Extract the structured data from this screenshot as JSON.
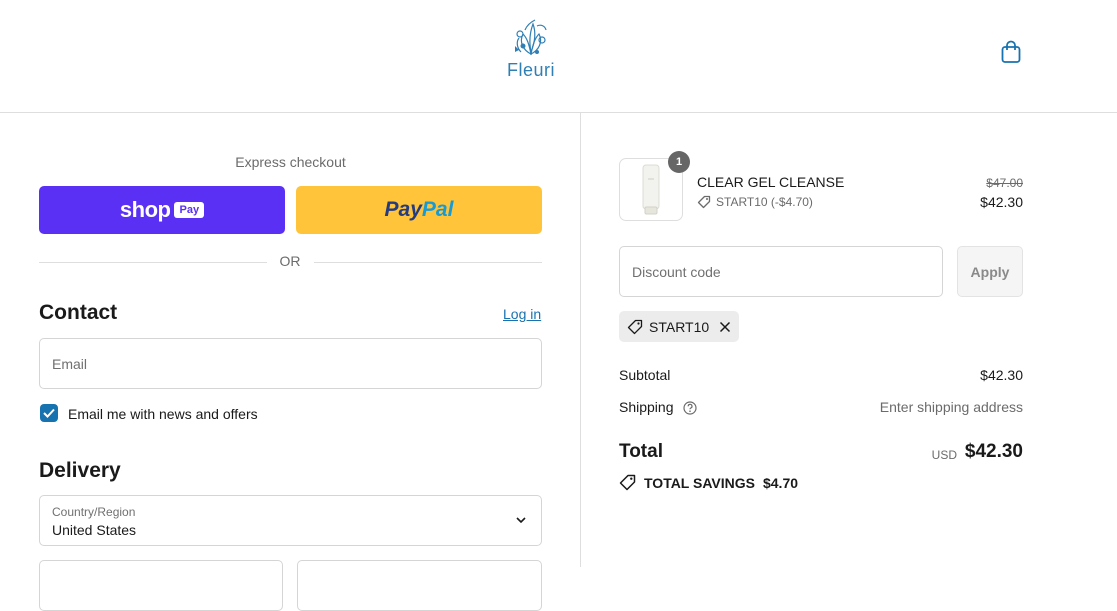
{
  "header": {
    "brand": "Fleuri",
    "cart_icon": "shopping-bag-icon"
  },
  "express": {
    "title": "Express checkout",
    "shop_word": "shop",
    "shop_badge": "Pay",
    "paypal_part1": "Pay",
    "paypal_part2": "Pal",
    "divider": "OR"
  },
  "contact": {
    "heading": "Contact",
    "login_label": "Log in",
    "email_placeholder": "Email",
    "newsletter_label": "Email me with news and offers",
    "newsletter_checked": true
  },
  "delivery": {
    "heading": "Delivery",
    "country_label": "Country/Region",
    "country_value": "United States"
  },
  "summary": {
    "item": {
      "name": "CLEAR GEL CLEANSE",
      "quantity": "1",
      "discount": "START10 (-$4.70)",
      "original_price": "$47.00",
      "price": "$42.30"
    },
    "discount_placeholder": "Discount code",
    "apply_label": "Apply",
    "applied_code": "START10",
    "subtotal_label": "Subtotal",
    "subtotal_value": "$42.30",
    "shipping_label": "Shipping",
    "shipping_value": "Enter shipping address",
    "total_label": "Total",
    "currency": "USD",
    "total_value": "$42.30",
    "savings_label": "TOTAL SAVINGS",
    "savings_value": "$4.70"
  },
  "colors": {
    "accent": "#1773b0",
    "shop_pay": "#5a31f4",
    "paypal": "#ffc439"
  }
}
